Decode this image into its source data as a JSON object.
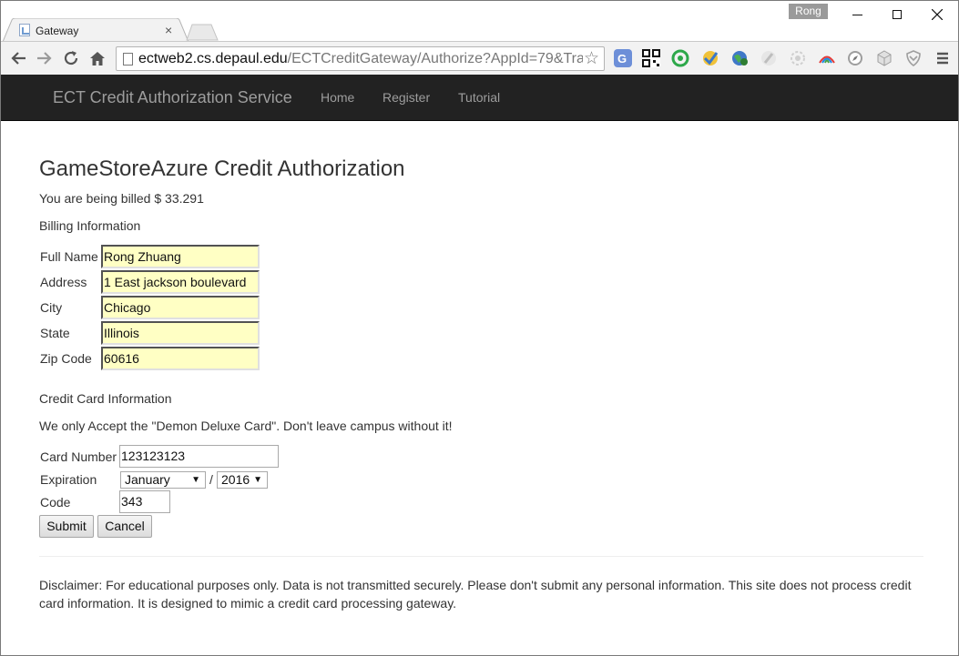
{
  "browser": {
    "tab_title": "Gateway",
    "tab_close": "×",
    "profile_name": "Rong",
    "url_host": "ectweb2.cs.depaul.edu",
    "url_path": "/ECTCreditGateway/Authorize?AppId=79&Tran",
    "nav_icons": [
      "back-icon",
      "forward-icon",
      "reload-icon",
      "home-icon"
    ],
    "extension_icons": [
      "translate-icon",
      "qr-code-icon",
      "evernote-icon",
      "checkmark-extension-icon",
      "globe-extension-icon",
      "feather-extension-icon",
      "gear-extension-icon",
      "rainbow-extension-icon",
      "compass-extension-icon",
      "cube-extension-icon",
      "shield-extension-icon",
      "menu-icon"
    ]
  },
  "navbar": {
    "brand": "ECT Credit Authorization Service",
    "links": [
      "Home",
      "Register",
      "Tutorial"
    ]
  },
  "page": {
    "title": "GameStoreAzure Credit Authorization",
    "billing_amount_text": "You are being billed $ 33.291",
    "billing_heading": "Billing Information",
    "billing_fields": [
      {
        "label": "Full Name",
        "value": "Rong Zhuang"
      },
      {
        "label": "Address",
        "value": "1 East jackson boulevard"
      },
      {
        "label": "City",
        "value": "Chicago"
      },
      {
        "label": "State",
        "value": "Illinois"
      },
      {
        "label": "Zip Code",
        "value": "60616"
      }
    ],
    "credit_heading": "Credit Card Information",
    "credit_note": "We only Accept the \"Demon Deluxe Card\". Don't leave campus without it!",
    "card_number_label": "Card Number",
    "card_number_value": "123123123",
    "expiration_label": "Expiration",
    "expiration_month": "January",
    "expiration_separator": "/",
    "expiration_year": "2016",
    "code_label": "Code",
    "code_value": "343",
    "submit_label": "Submit",
    "cancel_label": "Cancel",
    "disclaimer": "Disclaimer: For educational purposes only. Data is not transmitted securely. Please don't submit any personal information. This site does not process credit card information. It is designed to mimic a credit card processing gateway."
  },
  "colors": {
    "navbar_bg": "#222222",
    "navbar_text": "#9d9d9d",
    "autofill_yellow": "#ffffc4"
  }
}
